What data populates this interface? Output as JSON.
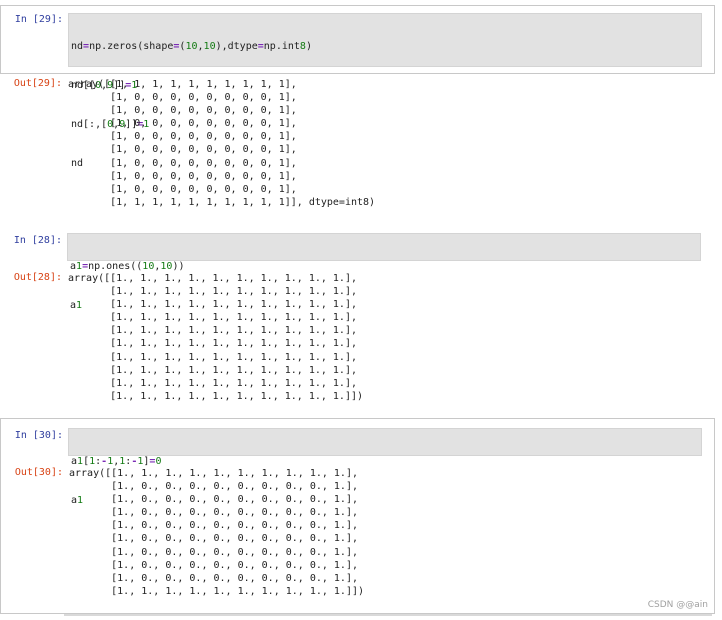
{
  "cells": [
    {
      "in_prompt": "In  [29]:",
      "out_prompt": "Out[29]:",
      "code_lines": [
        "nd=np.zeros(shape=(10,10),dtype=np.int8)",
        "nd[[0,9]]=1",
        "nd[:,[0,9]]=1",
        "nd"
      ],
      "output": "array([[1, 1, 1, 1, 1, 1, 1, 1, 1, 1],\n       [1, 0, 0, 0, 0, 0, 0, 0, 0, 1],\n       [1, 0, 0, 0, 0, 0, 0, 0, 0, 1],\n       [1, 0, 0, 0, 0, 0, 0, 0, 0, 1],\n       [1, 0, 0, 0, 0, 0, 0, 0, 0, 1],\n       [1, 0, 0, 0, 0, 0, 0, 0, 0, 1],\n       [1, 0, 0, 0, 0, 0, 0, 0, 0, 1],\n       [1, 0, 0, 0, 0, 0, 0, 0, 0, 1],\n       [1, 0, 0, 0, 0, 0, 0, 0, 0, 1],\n       [1, 1, 1, 1, 1, 1, 1, 1, 1, 1]], dtype=int8)"
    },
    {
      "in_prompt": "In  [28]:",
      "out_prompt": "Out[28]:",
      "code_lines": [
        "a1=np.ones((10,10))",
        "a1"
      ],
      "output": "array([[1., 1., 1., 1., 1., 1., 1., 1., 1., 1.],\n       [1., 1., 1., 1., 1., 1., 1., 1., 1., 1.],\n       [1., 1., 1., 1., 1., 1., 1., 1., 1., 1.],\n       [1., 1., 1., 1., 1., 1., 1., 1., 1., 1.],\n       [1., 1., 1., 1., 1., 1., 1., 1., 1., 1.],\n       [1., 1., 1., 1., 1., 1., 1., 1., 1., 1.],\n       [1., 1., 1., 1., 1., 1., 1., 1., 1., 1.],\n       [1., 1., 1., 1., 1., 1., 1., 1., 1., 1.],\n       [1., 1., 1., 1., 1., 1., 1., 1., 1., 1.],\n       [1., 1., 1., 1., 1., 1., 1., 1., 1., 1.]])"
    },
    {
      "in_prompt": "In  [30]:",
      "out_prompt": "Out[30]:",
      "code_lines": [
        "a1[1:-1,1:-1]=0",
        "a1"
      ],
      "output": "array([[1., 1., 1., 1., 1., 1., 1., 1., 1., 1.],\n       [1., 0., 0., 0., 0., 0., 0., 0., 0., 1.],\n       [1., 0., 0., 0., 0., 0., 0., 0., 0., 1.],\n       [1., 0., 0., 0., 0., 0., 0., 0., 0., 1.],\n       [1., 0., 0., 0., 0., 0., 0., 0., 0., 1.],\n       [1., 0., 0., 0., 0., 0., 0., 0., 0., 1.],\n       [1., 0., 0., 0., 0., 0., 0., 0., 0., 1.],\n       [1., 0., 0., 0., 0., 0., 0., 0., 0., 1.],\n       [1., 0., 0., 0., 0., 0., 0., 0., 0., 1.],\n       [1., 1., 1., 1., 1., 1., 1., 1., 1., 1.]])"
    }
  ],
  "watermark": "CSDN @@ain",
  "colors": {
    "in_prompt": "#303f9f",
    "out_prompt": "#d84315",
    "code_bg": "#e2e2e2",
    "operator": "#7a2bb5",
    "number": "#127a12"
  }
}
